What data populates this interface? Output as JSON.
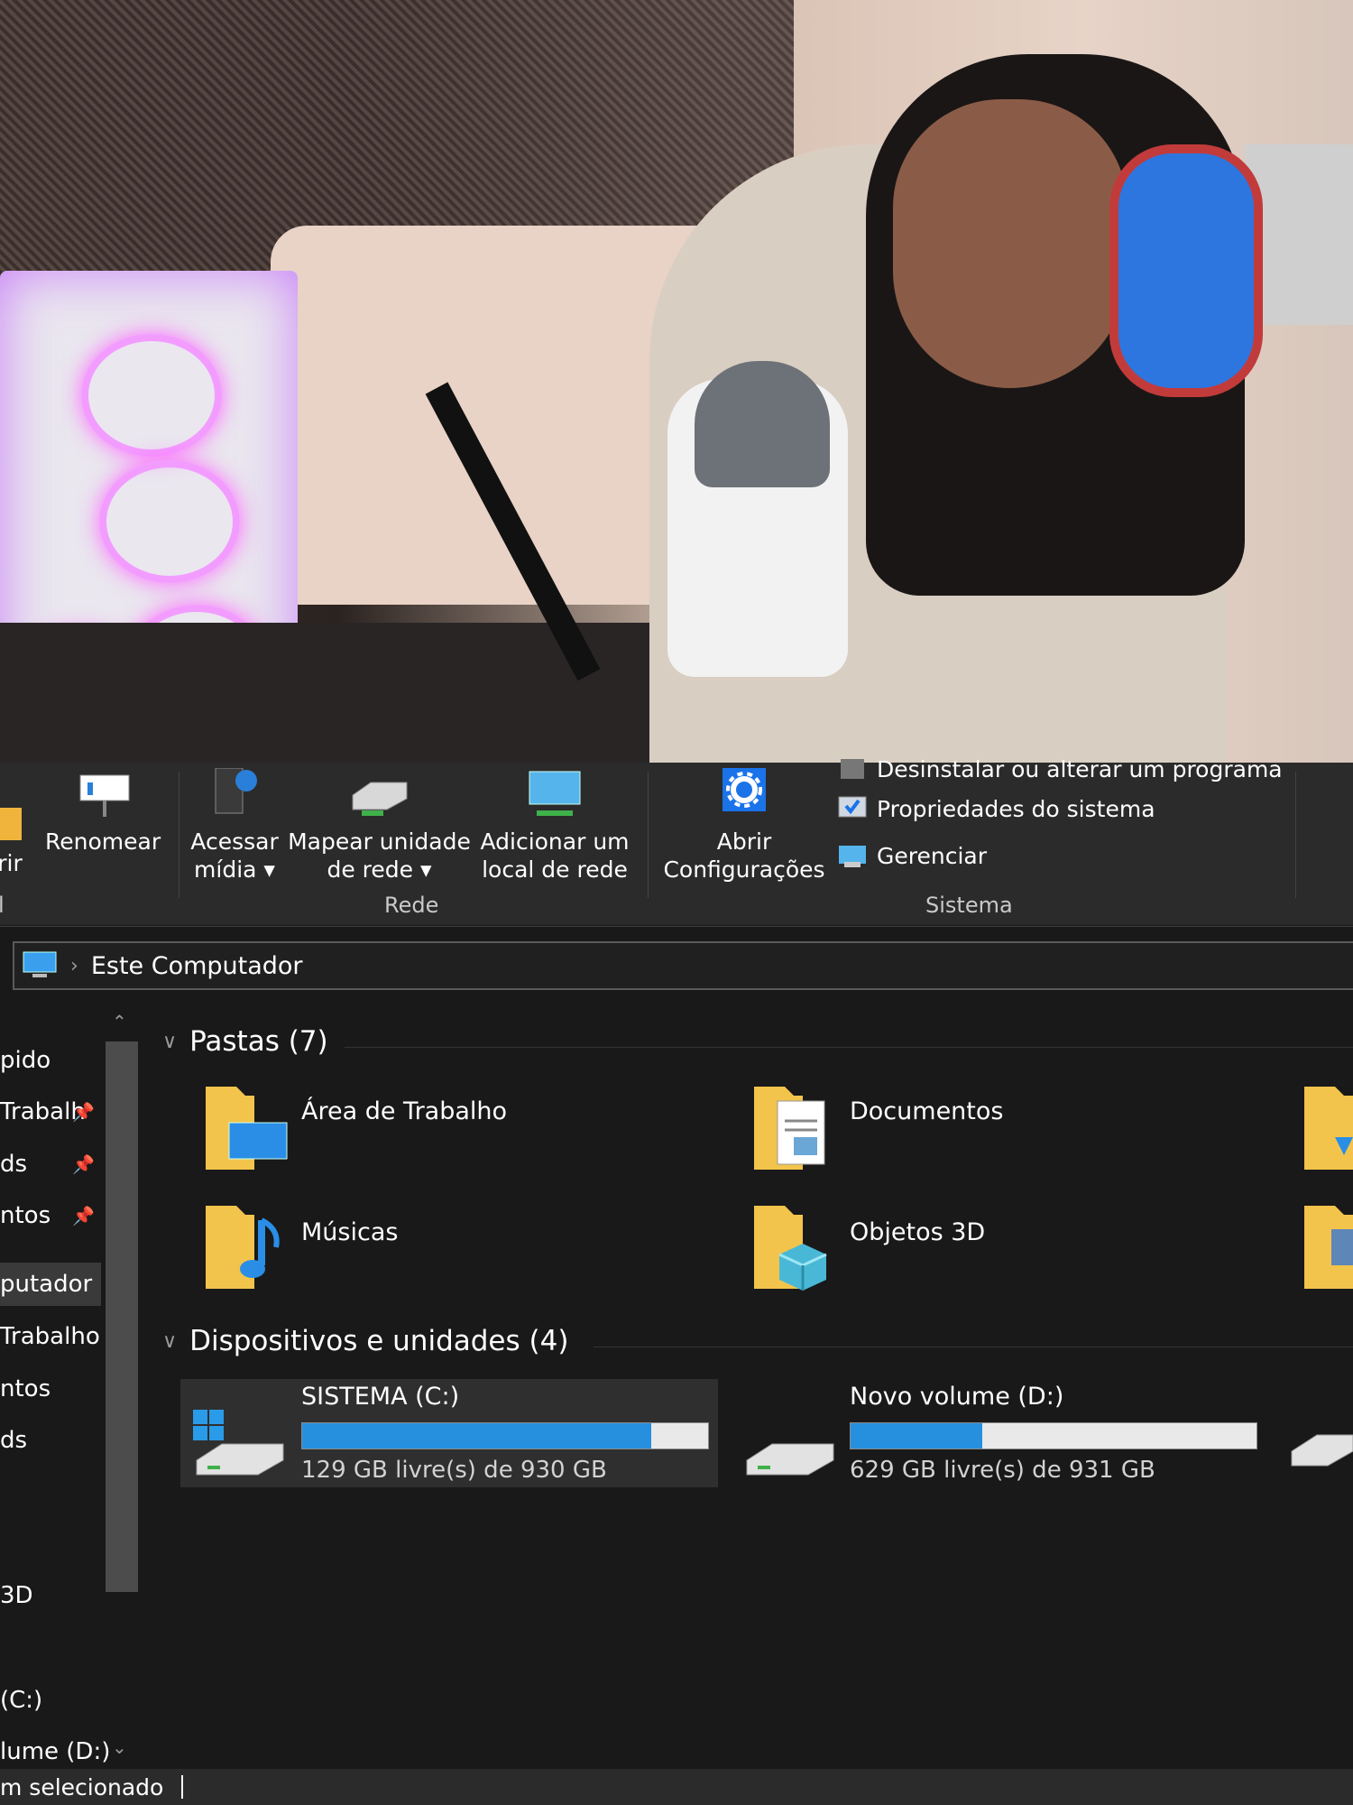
{
  "ribbon": {
    "btn_partial": "rir",
    "btn_rename": "Renomear",
    "btn_access_media": "Acessar mídia ▾",
    "btn_map_drive": "Mapear unidade de rede ▾",
    "btn_add_location": "Adicionar um local de rede",
    "btn_open_settings": "Abrir Configurações",
    "sys_uninstall": "Desinstalar ou alterar um programa",
    "sys_properties": "Propriedades do sistema",
    "sys_manage": "Gerenciar",
    "group_partial": "l",
    "group_network": "Rede",
    "group_system": "Sistema"
  },
  "address": {
    "crumb": "Este Computador"
  },
  "nav": {
    "items": [
      "pido",
      "Trabalh",
      "ds",
      "ntos",
      "putador",
      "Trabalho",
      "ntos",
      "ds",
      "3D",
      "(C:)",
      "lume (D:)"
    ]
  },
  "folders": {
    "header": "Pastas (7)",
    "items": [
      "Área de Trabalho",
      "Documentos",
      "Músicas",
      "Objetos 3D"
    ]
  },
  "devices": {
    "header": "Dispositivos e unidades (4)",
    "drives": [
      {
        "name": "SISTEMA (C:)",
        "free": "129 GB livre(s) de 930 GB",
        "used_fraction": 0.861
      },
      {
        "name": "Novo volume (D:)",
        "free": "629 GB livre(s) de 931 GB",
        "used_fraction": 0.324
      }
    ]
  },
  "status": {
    "text": "m selecionado"
  },
  "colors": {
    "bar_fill": "#2790de",
    "bg": "#191919",
    "ribbon": "#2b2b2b"
  }
}
